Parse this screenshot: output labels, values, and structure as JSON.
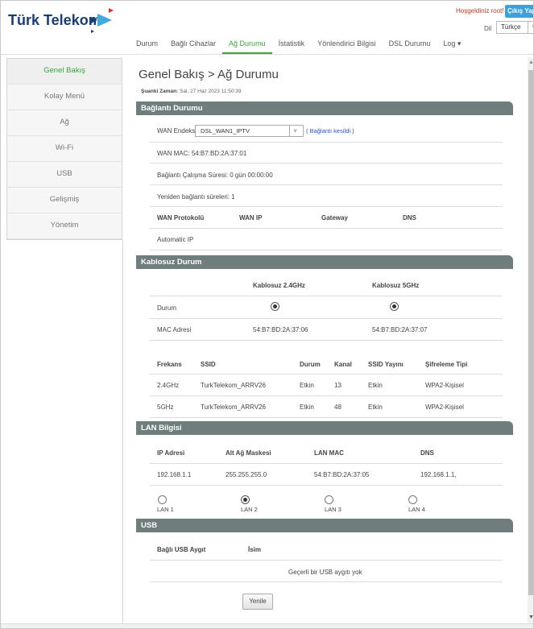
{
  "header": {
    "logo_text": "Türk Telekom",
    "welcome": "Hoşgeldiniz root!",
    "logout_label": "Çıkış Yap",
    "lang_label": "Dil",
    "lang_value": "Türkçe"
  },
  "nav": {
    "tabs": [
      "Durum",
      "Bağlı Cihazlar",
      "Ağ Durumu",
      "İstatistik",
      "Yönlendirici Bilgisi",
      "DSL Durumu",
      "Log ▾"
    ],
    "active_index": 2
  },
  "sidebar": {
    "items": [
      "Genel Bakış",
      "Kolay Menü",
      "Ağ",
      "Wi-Fi",
      "USB",
      "Gelişmiş",
      "Yönetim"
    ],
    "active_index": 0
  },
  "page": {
    "title": "Genel Bakış > Ağ Durumu",
    "time_label": "Şuanki Zaman:",
    "time_value": "Sal, 27 Haz 2023 11:50:39"
  },
  "connection": {
    "heading": "Bağlantı Durumu",
    "wan_index_label": "WAN Endeksi",
    "wan_index_value": "DSL_WAN1_IPTV",
    "wan_status": "( Bağlantı kesildi )",
    "wan_mac": "WAN MAC:  54:B7:BD:2A:37:01",
    "uptime": "Bağlantı Çalışma Süresi:  0 gün 00:00:00",
    "reconnect": "Yeniden bağlantı süreleri:  1",
    "col_protocol": "WAN Protokolü",
    "col_ip": "WAN IP",
    "col_gateway": "Gateway",
    "col_dns": "DNS",
    "protocol_value": "Automatic IP"
  },
  "wireless": {
    "heading": "Kablosuz Durum",
    "col_24": "Kablosuz 2.4GHz",
    "col_5": "Kablosuz 5GHz",
    "status_label": "Durum",
    "mac_label": "MAC Adresi",
    "mac_24": "54:B7:BD:2A:37:06",
    "mac_5": "54:B7:BD:2A:37:07",
    "table_headers": [
      "Frekans",
      "SSID",
      "Durum",
      "Kanal",
      "SSID Yayını",
      "Şifreleme Tipi"
    ],
    "rows": [
      [
        "2.4GHz",
        "TurkTelekom_ARRV26",
        "Etkin",
        "13",
        "Etkin",
        "WPA2-Kişisel"
      ],
      [
        "5GHz",
        "TurkTelekom_ARRV26",
        "Etkin",
        "48",
        "Etkin",
        "WPA2-Kişisel"
      ]
    ]
  },
  "lan": {
    "heading": "LAN Bilgisi",
    "col_ip": "IP Adresi",
    "col_mask": "Alt Ağ Maskesi",
    "col_mac": "LAN MAC",
    "col_dns": "DNS",
    "ip": "192.168.1.1",
    "mask": "255.255.255.0",
    "mac": "54:B7:BD:2A:37:05",
    "dns": "192.168.1.1,",
    "ports": [
      "LAN 1",
      "LAN 2",
      "LAN 3",
      "LAN 4"
    ],
    "active_port": 1
  },
  "usb": {
    "heading": "USB",
    "col_device": "Bağlı USB Aygıt",
    "col_name": "İsim",
    "empty": "Geçerli bir USB aygıtı yok"
  },
  "refresh_label": "Yenile"
}
